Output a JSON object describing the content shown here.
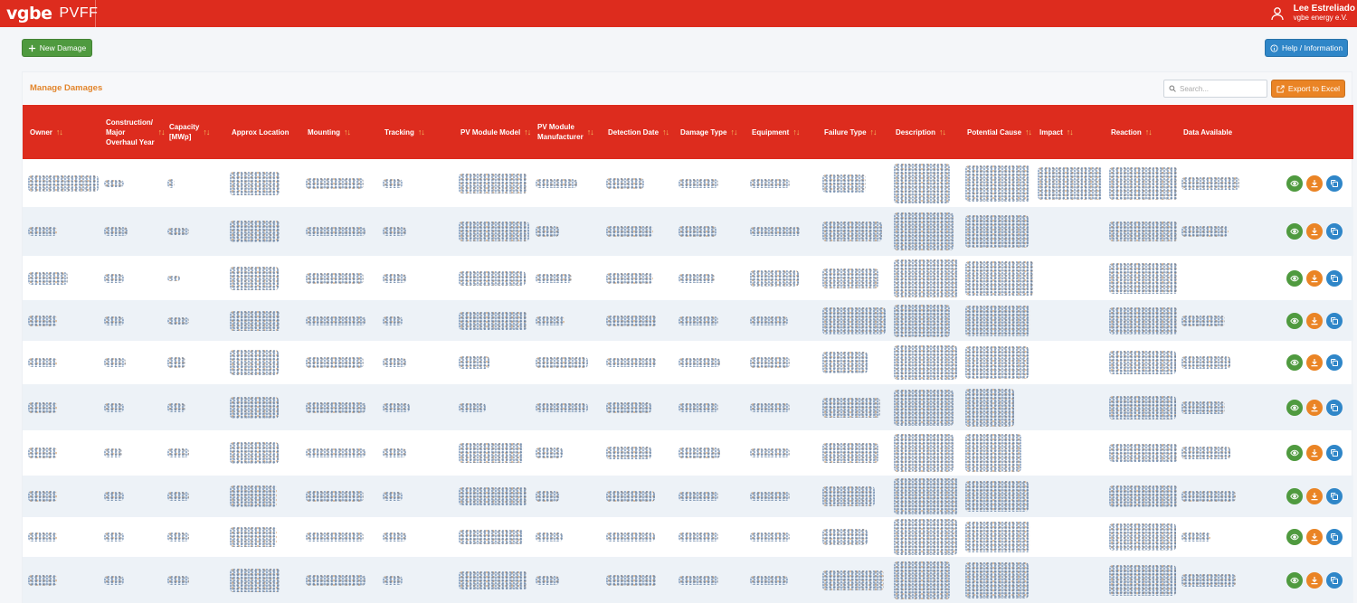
{
  "app": {
    "logo": "vgbe",
    "name": "PVFF"
  },
  "user": {
    "name": "Lee Estreliado",
    "org": "vgbe energy e.V."
  },
  "toolbar": {
    "new_label": "New Damage",
    "help_label": "Help / Information"
  },
  "panel": {
    "title": "Manage Damages",
    "search_placeholder": "Search...",
    "export_label": "Export to Excel"
  },
  "sort_glyph": "↑↓",
  "columns": [
    {
      "label": "Owner",
      "sortable": true
    },
    {
      "label": "Construction/\nMajor\nOverhaul Year",
      "sortable": true
    },
    {
      "label": "Capacity\n[MWp]",
      "sortable": true
    },
    {
      "label": "Approx Location",
      "sortable": false
    },
    {
      "label": "Mounting",
      "sortable": true
    },
    {
      "label": "Tracking",
      "sortable": true
    },
    {
      "label": "PV Module Model",
      "sortable": true
    },
    {
      "label": "PV Module\nManufacturer",
      "sortable": true
    },
    {
      "label": "Detection Date",
      "sortable": true
    },
    {
      "label": "Damage Type",
      "sortable": true
    },
    {
      "label": "Equipment",
      "sortable": true
    },
    {
      "label": "Failure Type",
      "sortable": true
    },
    {
      "label": "Description",
      "sortable": true
    },
    {
      "label": "Potential Cause",
      "sortable": true
    },
    {
      "label": "Impact",
      "sortable": true
    },
    {
      "label": "Reaction",
      "sortable": true
    },
    {
      "label": "Data Available",
      "sortable": false
    }
  ],
  "row_count": 10,
  "row_actions": [
    "view-icon",
    "download-icon",
    "copy-icon"
  ],
  "colors": {
    "brand_red": "#dd2c1e",
    "accent_orange": "#ea8425",
    "green": "#4f9a3f",
    "blue": "#2f86c8",
    "sort_gold": "#f1c15e"
  }
}
